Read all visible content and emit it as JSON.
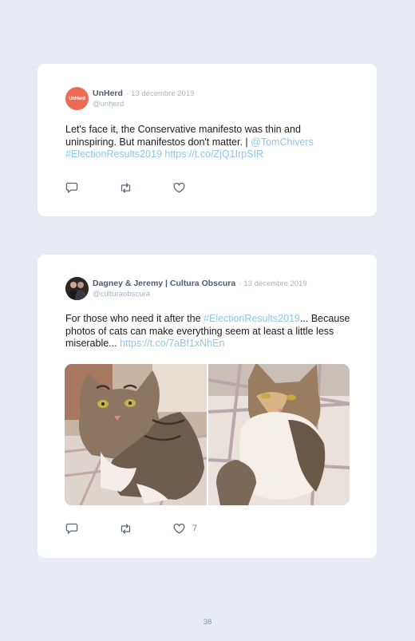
{
  "colors": {
    "background": "#e8ebf4",
    "card": "#ffffff",
    "link": "#8fc6e6",
    "name": "#4e5d6e",
    "muted": "#aab3bf",
    "unherd_brand": "#ef6a52"
  },
  "tweets": [
    {
      "avatar_text": "UnHerd",
      "name": "UnHerd",
      "date": "· 13 décembre 2019",
      "handle": "@unherd",
      "text_plain": "Let's face it, the Conservative manifesto was thin and uninspiring. But manifestos don't matter. | ",
      "mention": "@TomChivers",
      "hashtag": "#ElectionResults2019",
      "url": "https://t.co/ZjQ1IrpSIR",
      "like_count": ""
    },
    {
      "name": "Dagney & Jeremy | Cultura Obscura",
      "date": "· 13 décembre 2019",
      "handle": "@culturaobscura",
      "text_before": "For those who need it after the ",
      "hashtag": "#ElectionResults2019",
      "text_after": "... Because photos of cats can make everything seem at least a little less miserable... ",
      "url": "https://t.co/7aBf1xNhEn",
      "like_count": "7",
      "photos": [
        "tabby cat lying on blanket",
        "calico cat lying on its back"
      ]
    }
  ],
  "page_number": "38"
}
